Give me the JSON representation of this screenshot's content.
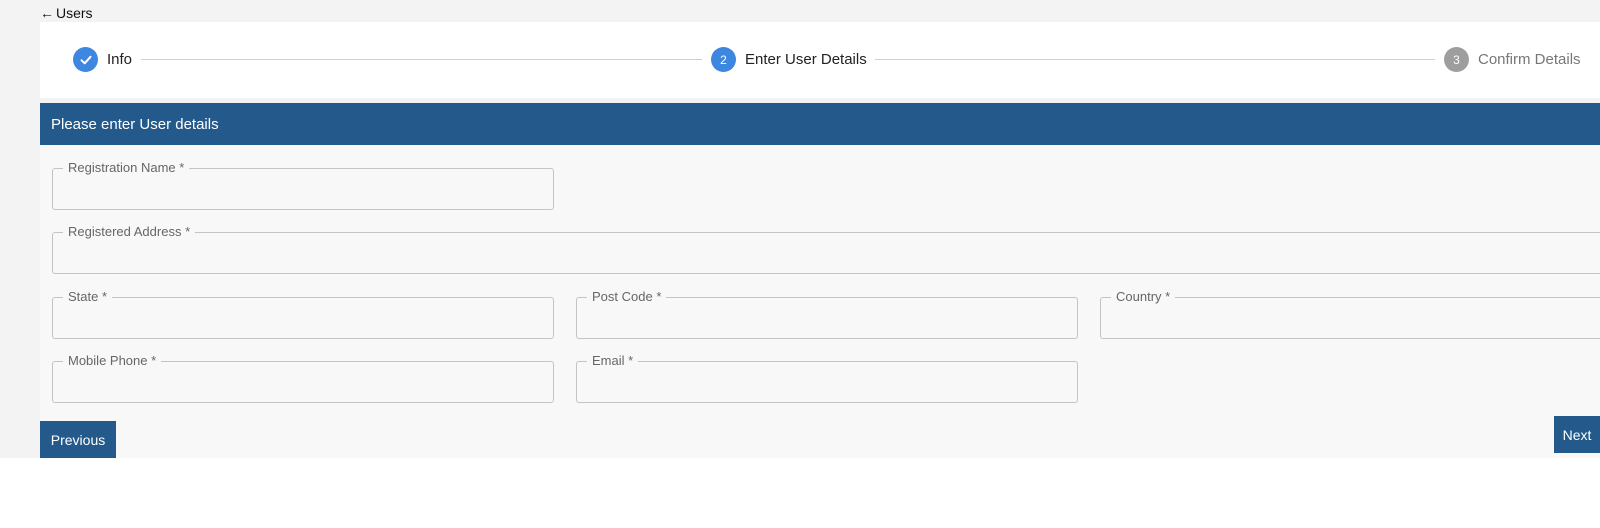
{
  "nav": {
    "back_arrow": "←",
    "back_label": "Users"
  },
  "stepper": {
    "steps": [
      {
        "number": "1",
        "label": "Info",
        "status": "completed",
        "icon": "check-icon"
      },
      {
        "number": "2",
        "label": "Enter User Details",
        "status": "active"
      },
      {
        "number": "3",
        "label": "Confirm Details",
        "status": "pending"
      }
    ]
  },
  "section": {
    "title": "Please enter User details"
  },
  "form": {
    "registration_name": {
      "label": "Registration Name *",
      "value": ""
    },
    "registered_address": {
      "label": "Registered Address *",
      "value": ""
    },
    "state": {
      "label": "State *",
      "value": ""
    },
    "post_code": {
      "label": "Post Code *",
      "value": ""
    },
    "country": {
      "label": "Country *",
      "value": ""
    },
    "mobile_phone": {
      "label": "Mobile Phone *",
      "value": ""
    },
    "email": {
      "label": "Email *",
      "value": ""
    }
  },
  "buttons": {
    "previous": "Previous",
    "next": "Next"
  },
  "colors": {
    "primary": "#23598b",
    "step_active": "#3d87e0",
    "step_pending": "#9e9e9e"
  }
}
